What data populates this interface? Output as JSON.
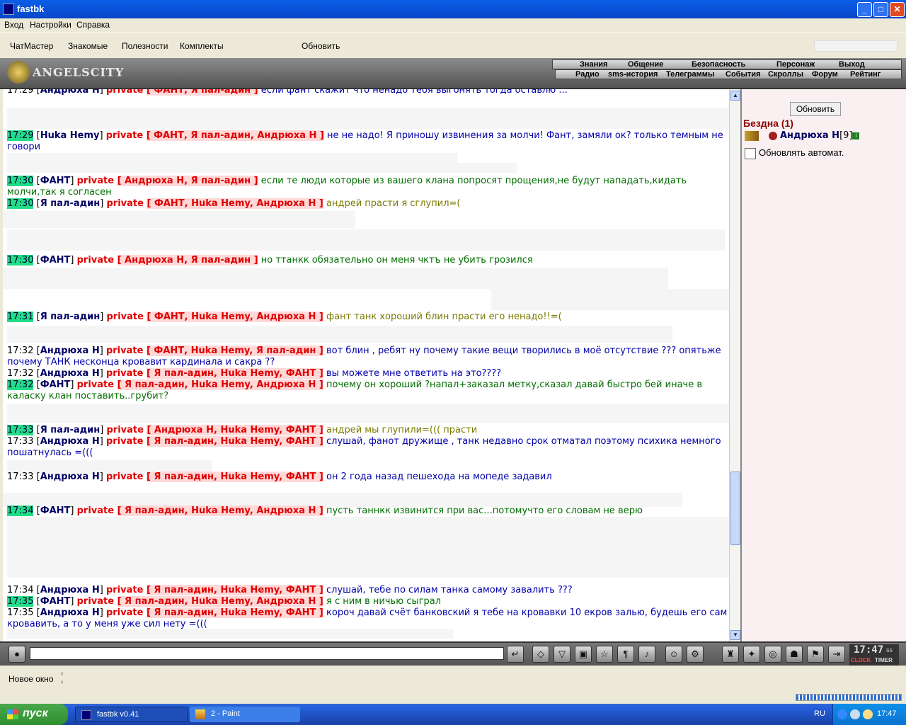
{
  "window": {
    "title": "fastbk",
    "btn_min": "_",
    "btn_max": "□",
    "btn_close": "✕"
  },
  "menu": [
    "Вход",
    "Настройки",
    "Справка"
  ],
  "toolbar": {
    "items": [
      "ЧатМастер",
      "Знакомые",
      "Полезности",
      "Комплекты"
    ],
    "refresh": "Обновить"
  },
  "header": {
    "logo": "ANGELSCITY",
    "nav_top": [
      "Знания",
      "Общение",
      "Безопасность",
      "Персонаж",
      "Выход"
    ],
    "nav_bottom": [
      "Радио",
      "sms-история",
      "Телеграммы",
      "События",
      "Скроллы",
      "Форум",
      "Рейтинг"
    ]
  },
  "chat": [
    {
      "time": "17:29",
      "hl": false,
      "nick": "Андрюха Н",
      "recipients": "ФАНТ, Я пал-адин",
      "text": "если фант скажит что ненадо тебя выгонять тогда оставлю ...",
      "color": "blue"
    },
    {
      "time": "17:29",
      "hl": true,
      "nick": "Huka Hemy",
      "recipients": "ФАНТ, Я пал-адин, Андрюха Н",
      "text": "не не надо! Я приношу извинения за молчи! Фант, замяли ок? только темным не говори",
      "color": "blue"
    },
    {
      "time": "17:30",
      "hl": true,
      "nick": "ФАНТ",
      "recipients": "Андрюха Н, Я пал-адин",
      "text": "если те люди которые из вашего клана попросят прощения,не будут нападать,кидать молчи,так я согласен",
      "color": "green"
    },
    {
      "time": "17:30",
      "hl": true,
      "nick": "Я пал-адин",
      "recipients": "ФАНТ, Huka Hemy, Андрюха Н",
      "text": "андрей прасти я сглупил=(",
      "color": "olive"
    },
    {
      "time": "17:30",
      "hl": true,
      "nick": "ФАНТ",
      "recipients": "Андрюха Н, Я пал-адин",
      "text": "но ттанкк обязательно он меня чктъ не убить грозился",
      "color": "green"
    },
    {
      "time": "17:31",
      "hl": true,
      "nick": "Я пал-адин",
      "recipients": "ФАНТ, Huka Hemy, Андрюха Н",
      "text": "фант танк хороший блин прасти его ненадо!!=(",
      "color": "olive"
    },
    {
      "time": "17:32",
      "hl": false,
      "nick": "Андрюха Н",
      "recipients": "ФАНТ, Huka Hemy, Я пал-адин",
      "text": "вот блин , ребят ну почему такие вещи творились в моё отсутствие ??? опятьже почему ТАНК несконца кровавит кардинала и сакра ??",
      "color": "blue"
    },
    {
      "time": "17:32",
      "hl": false,
      "nick": "Андрюха Н",
      "recipients": "Я пал-адин, Huka Hemy, ФАНТ",
      "text": "вы можете мне ответить на это????",
      "color": "blue"
    },
    {
      "time": "17:32",
      "hl": true,
      "nick": "ФАНТ",
      "recipients": "Я пал-адин, Huka Hemy, Андрюха Н",
      "text": "почему он хороший ?напал+заказал метку,сказал давай быстро бей иначе в каласку клан поставить..грубит?",
      "color": "green"
    },
    {
      "time": "17:33",
      "hl": true,
      "nick": "Я пал-адин",
      "recipients": "Андрюха Н, Huka Hemy, ФАНТ",
      "text": "андрей мы глупили=((( прасти",
      "color": "olive"
    },
    {
      "time": "17:33",
      "hl": false,
      "nick": "Андрюха Н",
      "recipients": "Я пал-адин, Huka Hemy, ФАНТ",
      "text": "слушай, фанот дружище , танк недавно срок отматал поэтому психика немного пошатнулась =(((",
      "color": "blue"
    },
    {
      "time": "17:33",
      "hl": false,
      "nick": "Андрюха Н",
      "recipients": "Я пал-адин, Huka Hemy, ФАНТ",
      "text": "он 2 года назад пешехода на мопеде задавил",
      "color": "blue"
    },
    {
      "time": "17:34",
      "hl": true,
      "nick": "ФАНТ",
      "recipients": "Я пал-адин, Huka Hemy, Андрюха Н",
      "text": "пусть таннкк извинится при вас...потомучто его словам не верю",
      "color": "green"
    },
    {
      "time": "17:34",
      "hl": false,
      "nick": "Андрюха Н",
      "recipients": "Я пал-адин, Huka Hemy, ФАНТ",
      "text": "слушай, тебе по силам танка самому завалить ???",
      "color": "blue"
    },
    {
      "time": "17:35",
      "hl": true,
      "nick": "ФАНТ",
      "recipients": "Я пал-адин, Huka Hemy, Андрюха Н",
      "text": "я с ним в ничью сыграл",
      "color": "green"
    },
    {
      "time": "17:35",
      "hl": false,
      "nick": "Андрюха Н",
      "recipients": "Я пал-адин, Huka Hemy, ФАНТ",
      "text": "короч давай счёт банковский я тебе на кровавки 10 екров залью, будешь его сам кровавить, а то у меня уже сил нету =(((",
      "color": "blue"
    }
  ],
  "private_word": "private",
  "sidebar": {
    "refresh": "Обновить",
    "room": "Бездна (1)",
    "user_name": "Андрюха Н",
    "user_level": "[9]",
    "auto_label": "Обновлять автомат."
  },
  "input": {
    "value": "",
    "clock": "17:47",
    "clock_suffix": "ss",
    "clock_label": "CLOCK",
    "timer_label": "TIMER"
  },
  "bottom": {
    "tab": "Новое окно"
  },
  "taskbar": {
    "start": "пуск",
    "tasks": [
      "fastbk v0.41",
      "2 - Paint"
    ],
    "lang": "RU",
    "time": "17:47"
  }
}
